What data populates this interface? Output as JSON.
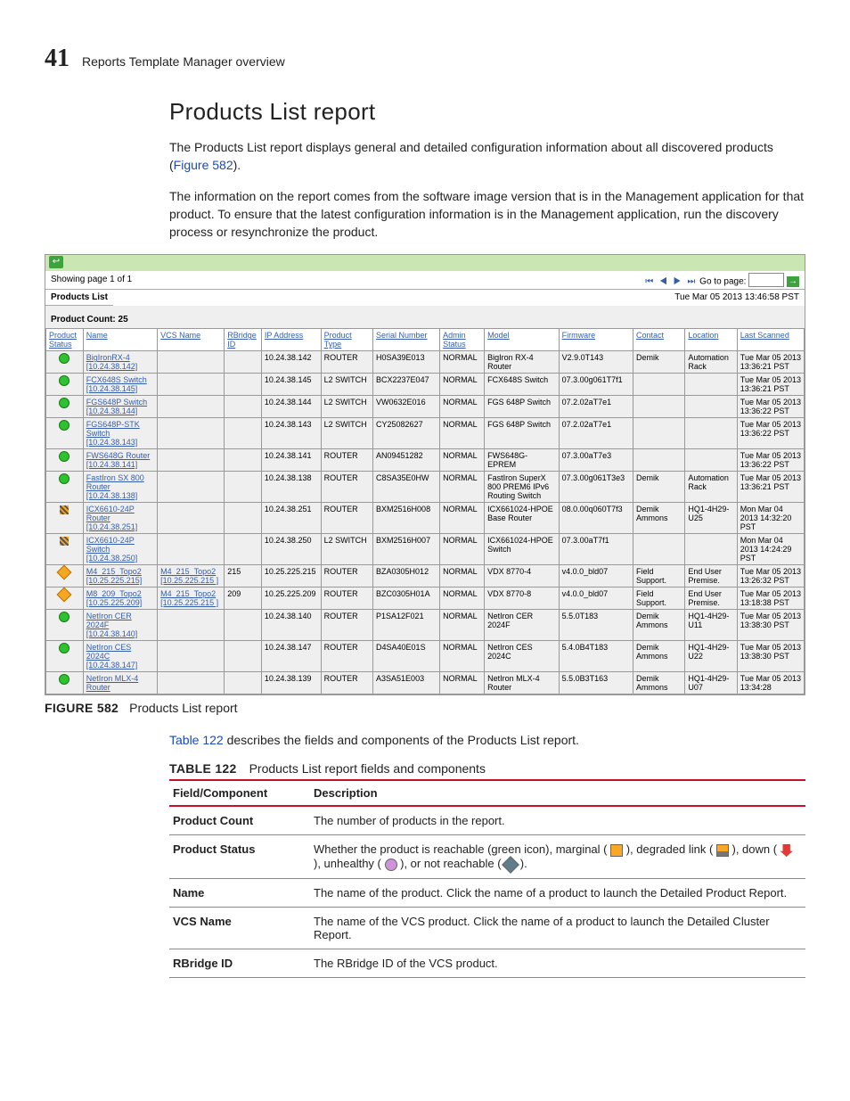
{
  "page": {
    "chapter_number": "41",
    "chapter_title": "Reports Template Manager overview"
  },
  "section": {
    "heading": "Products List report",
    "para1_a": "The Products List report displays general and detailed configuration information about all discovered products (",
    "para1_ref": "Figure 582",
    "para1_b": ").",
    "para2": "The information on the report comes from the software image version that is in the Management application for that product. To ensure that the latest configuration information is in the Management application, run the discovery process or resynchronize the product."
  },
  "screenshot": {
    "paging": "Showing page  1  of  1",
    "goto": "Go to page:",
    "title_block": "Products List",
    "timestamp": "Tue Mar 05 2013 13:46:58 PST",
    "count_label": "Product Count: 25",
    "columns": [
      "Product Status",
      "Name",
      "VCS Name",
      "RBridge ID",
      "IP Address",
      "Product Type",
      "Serial Number",
      "Admin Status",
      "Model",
      "Firmware",
      "Contact",
      "Location",
      "Last Scanned"
    ],
    "rows": [
      {
        "status": "green",
        "name": "BigIronRX-4 [10.24.38.142]",
        "vcs": "",
        "rb": "",
        "ip": "10.24.38.142",
        "ptype": "ROUTER",
        "serial": "H0SA39E013",
        "admin": "NORMAL",
        "model": "BigIron RX-4 Router",
        "fw": "V2.9.0T143",
        "contact": "Demik",
        "loc": "Automation Rack",
        "scan": "Tue Mar 05 2013 13:36:21 PST"
      },
      {
        "status": "green",
        "name": "FCX648S Switch [10.24.38.145]",
        "vcs": "",
        "rb": "",
        "ip": "10.24.38.145",
        "ptype": "L2 SWITCH",
        "serial": "BCX2237E047",
        "admin": "NORMAL",
        "model": "FCX648S Switch",
        "fw": "07.3.00g061T7f1",
        "contact": "",
        "loc": "",
        "scan": "Tue Mar 05 2013 13:36:21 PST"
      },
      {
        "status": "green",
        "name": "FGS648P Switch [10.24.38.144]",
        "vcs": "",
        "rb": "",
        "ip": "10.24.38.144",
        "ptype": "L2 SWITCH",
        "serial": "VW0632E016",
        "admin": "NORMAL",
        "model": "FGS 648P Switch",
        "fw": "07.2.02aT7e1",
        "contact": "",
        "loc": "",
        "scan": "Tue Mar 05 2013 13:36:22 PST"
      },
      {
        "status": "green",
        "name": "FGS648P-STK Switch [10.24.38.143]",
        "vcs": "",
        "rb": "",
        "ip": "10.24.38.143",
        "ptype": "L2 SWITCH",
        "serial": "CY25082627",
        "admin": "NORMAL",
        "model": "FGS 648P Switch",
        "fw": "07.2.02aT7e1",
        "contact": "",
        "loc": "",
        "scan": "Tue Mar 05 2013 13:36:22 PST"
      },
      {
        "status": "green",
        "name": "FWS648G Router [10.24.38.141]",
        "vcs": "",
        "rb": "",
        "ip": "10.24.38.141",
        "ptype": "ROUTER",
        "serial": "AN09451282",
        "admin": "NORMAL",
        "model": "FWS648G-EPREM",
        "fw": "07.3.00aT7e3",
        "contact": "",
        "loc": "",
        "scan": "Tue Mar 05 2013 13:36:22 PST"
      },
      {
        "status": "green",
        "name": "FastIron SX 800 Router [10.24.38.138]",
        "vcs": "",
        "rb": "",
        "ip": "10.24.38.138",
        "ptype": "ROUTER",
        "serial": "C8SA35E0HW",
        "admin": "NORMAL",
        "model": "FastIron SuperX 800 PREM6 IPv6 Routing Switch",
        "fw": "07.3.00g061T3e3",
        "contact": "Demik",
        "loc": "Automation Rack",
        "scan": "Tue Mar 05 2013 13:36:21 PST"
      },
      {
        "status": "hatch",
        "name": "ICX6610-24P Router [10.24.38.251]",
        "vcs": "",
        "rb": "",
        "ip": "10.24.38.251",
        "ptype": "ROUTER",
        "serial": "BXM2516H008",
        "admin": "NORMAL",
        "model": "ICX661024-HPOE Base Router",
        "fw": "08.0.00q060T7f3",
        "contact": "Demik Ammons",
        "loc": "HQ1-4H29-U25",
        "scan": "Mon Mar 04 2013 14:32:20 PST"
      },
      {
        "status": "hatch",
        "name": "ICX6610-24P Switch [10.24.38.250]",
        "vcs": "",
        "rb": "",
        "ip": "10.24.38.250",
        "ptype": "L2 SWITCH",
        "serial": "BXM2516H007",
        "admin": "NORMAL",
        "model": "ICX661024-HPOE Switch",
        "fw": "07.3.00aT7f1",
        "contact": "",
        "loc": "",
        "scan": "Mon Mar 04 2013 14:24:29 PST"
      },
      {
        "status": "orange",
        "name": "M4_215_Topo2 [10.25.225.215]",
        "vcs": "M4_215_Topo2 [10.25.225.215 ]",
        "rb": "215",
        "ip": "10.25.225.215",
        "ptype": "ROUTER",
        "serial": "BZA0305H012",
        "admin": "NORMAL",
        "model": "VDX 8770-4",
        "fw": "v4.0.0_bld07",
        "contact": "Field Support.",
        "loc": "End User Premise.",
        "scan": "Tue Mar 05 2013 13:26:32 PST"
      },
      {
        "status": "orange",
        "name": "M8_209_Topo2 [10.25.225.209]",
        "vcs": "M4_215_Topo2 [10.25.225.215 ]",
        "rb": "209",
        "ip": "10.25.225.209",
        "ptype": "ROUTER",
        "serial": "BZC0305H01A",
        "admin": "NORMAL",
        "model": "VDX 8770-8",
        "fw": "v4.0.0_bld07",
        "contact": "Field Support.",
        "loc": "End User Premise.",
        "scan": "Tue Mar 05 2013 13:18:38 PST"
      },
      {
        "status": "green",
        "name": "NetIron CER 2024F [10.24.38.140]",
        "vcs": "",
        "rb": "",
        "ip": "10.24.38.140",
        "ptype": "ROUTER",
        "serial": "P1SA12F021",
        "admin": "NORMAL",
        "model": "NetIron CER 2024F",
        "fw": "5.5.0T183",
        "contact": "Demik Ammons",
        "loc": "HQ1-4H29-U11",
        "scan": "Tue Mar 05 2013 13:38:30 PST"
      },
      {
        "status": "green",
        "name": "NetIron CES 2024C [10.24.38.147]",
        "vcs": "",
        "rb": "",
        "ip": "10.24.38.147",
        "ptype": "ROUTER",
        "serial": "D4SA40E01S",
        "admin": "NORMAL",
        "model": "NetIron CES 2024C",
        "fw": "5.4.0B4T183",
        "contact": "Demik Ammons",
        "loc": "HQ1-4H29-U22",
        "scan": "Tue Mar 05 2013 13:38:30 PST"
      },
      {
        "status": "green",
        "name": "NetIron MLX-4 Router",
        "vcs": "",
        "rb": "",
        "ip": "10.24.38.139",
        "ptype": "ROUTER",
        "serial": "A3SA51E003",
        "admin": "NORMAL",
        "model": "NetIron MLX-4 Router",
        "fw": "5.5.0B3T163",
        "contact": "Demik Ammons",
        "loc": "HQ1-4H29-U07",
        "scan": "Tue Mar 05 2013 13:34:28"
      }
    ]
  },
  "figure": {
    "label": "FIGURE 582",
    "caption": "Products List report"
  },
  "mid_para_a": "",
  "mid_ref": "Table 122",
  "mid_para_b": " describes the fields and components of the Products List report.",
  "table122": {
    "label": "TABLE 122",
    "caption": "Products List report fields and components",
    "head_field": "Field/Component",
    "head_desc": "Description",
    "rows": [
      {
        "f": "Product Count",
        "d": "The number of products in the report."
      },
      {
        "f": "Product Status",
        "d_pre": "Whether the product is reachable (green icon), marginal ( ",
        "d_mid1": " ), degraded link ( ",
        "d_mid2": " ), down ( ",
        "d_mid3": " ), unhealthy ( ",
        "d_mid4": " ), or not reachable ( ",
        "d_post": " )."
      },
      {
        "f": "Name",
        "d": "The name of the product. Click the name of a product to launch the Detailed Product Report."
      },
      {
        "f": "VCS Name",
        "d": "The name of the VCS product. Click the name of a product to launch the Detailed Cluster Report."
      },
      {
        "f": "RBridge ID",
        "d": "The RBridge ID of the VCS product."
      }
    ]
  }
}
